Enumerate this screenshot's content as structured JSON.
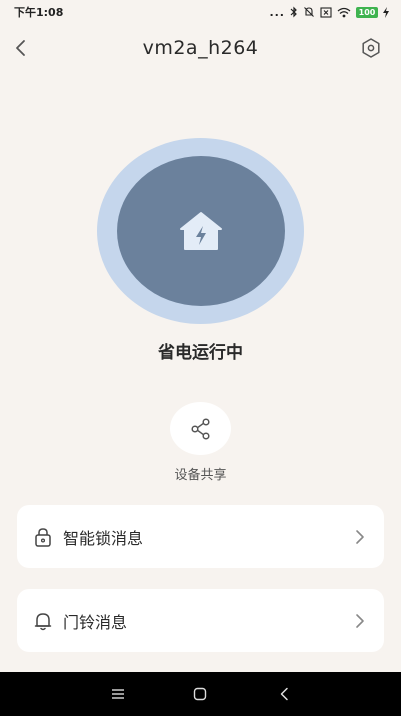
{
  "status_bar": {
    "time": "下午1:08",
    "dots": "...",
    "battery": "100"
  },
  "header": {
    "title": "vm2a_h264"
  },
  "power": {
    "status_text": "省电运行中"
  },
  "share": {
    "label": "设备共享"
  },
  "menu": {
    "items": [
      {
        "label": "智能锁消息",
        "icon": "lock-icon"
      },
      {
        "label": "门铃消息",
        "icon": "bell-icon"
      }
    ]
  },
  "colors": {
    "background": "#f7f3ef",
    "ring": "#c5d6ec",
    "core": "#6b819c",
    "house": "#e3ecf7",
    "battery": "#3fb34f"
  }
}
